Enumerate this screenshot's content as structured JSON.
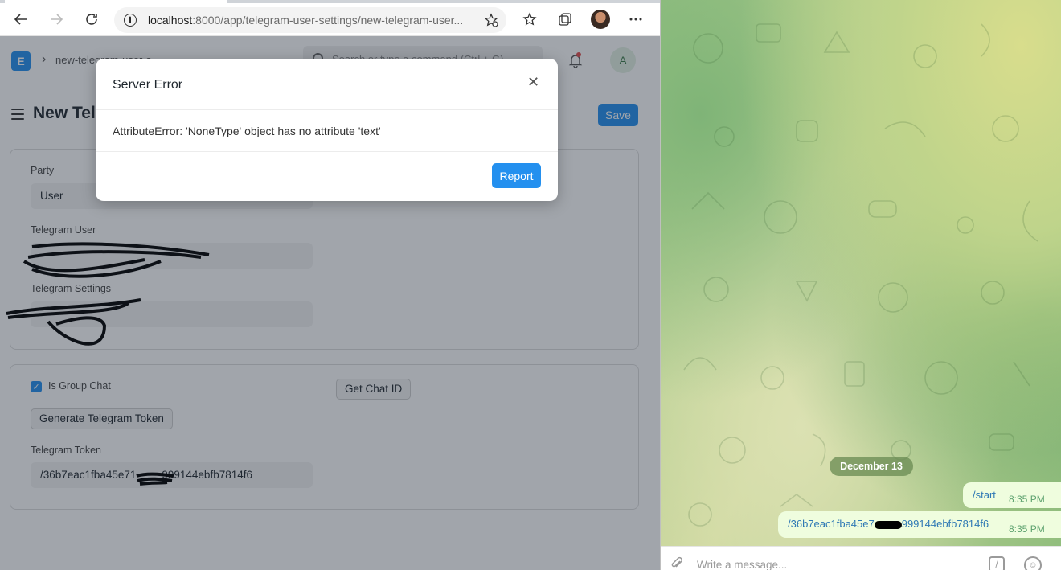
{
  "browser": {
    "url_host": "localhost",
    "url_path": ":8000/app/telegram-user-settings/new-telegram-user...",
    "icons": [
      "back-icon",
      "forward-icon",
      "reload-icon",
      "info-icon",
      "add-favorite-icon",
      "favorites-icon",
      "collections-icon",
      "profile-avatar",
      "more-icon"
    ]
  },
  "app": {
    "logo_letter": "E",
    "breadcrumb": "new-telegram-user-s...",
    "search_placeholder": "Search or type a command (Ctrl + G)",
    "user_initial": "A",
    "page_title": "New Tel",
    "save_label": "Save",
    "fields": {
      "party_label": "Party",
      "party_value": "User",
      "telegram_user_label": "Telegram User",
      "telegram_user_value": "",
      "telegram_settings_label": "Telegram Settings",
      "telegram_settings_value": "",
      "is_group_chat_label": "Is Group Chat",
      "is_group_chat_checked": true,
      "get_chat_id_label": "Get Chat ID",
      "generate_token_label": "Generate Telegram Token",
      "telegram_token_label": "Telegram Token",
      "telegram_token_value": "/36b7eac1fba45e71",
      "telegram_token_value_suffix": "999144ebfb7814f6"
    }
  },
  "modal": {
    "title": "Server Error",
    "message": "AttributeError: 'NoneType' object has no attribute 'text'",
    "report_label": "Report",
    "close_glyph": "✕"
  },
  "telegram": {
    "date_label": "December 13",
    "messages": [
      {
        "text": "/start",
        "time": "8:35 PM"
      },
      {
        "text_prefix": "/36b7eac1fba45e7",
        "text_suffix": "999144ebfb7814f6",
        "time": "8:35 PM"
      }
    ],
    "input_placeholder": "Write a message..."
  },
  "colors": {
    "primary": "#2490ef",
    "telegram_bubble": "#effdde"
  }
}
